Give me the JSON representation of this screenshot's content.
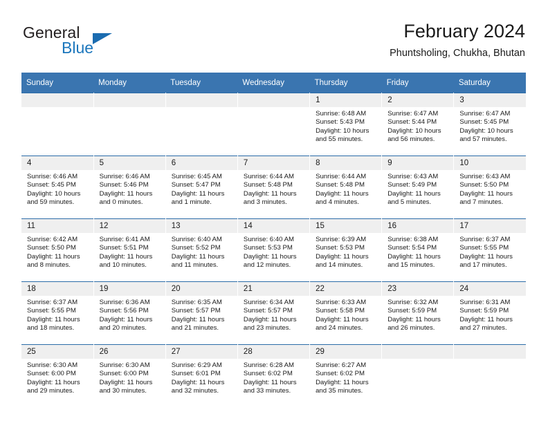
{
  "brand": {
    "name_part1": "General",
    "name_part2": "Blue",
    "logo_icon": "triangle-flag-icon"
  },
  "header": {
    "title": "February 2024",
    "location": "Phuntsholing, Chukha, Bhutan"
  },
  "theme": {
    "header_blue": "#3a75b0",
    "rule_blue": "#2b6ca8",
    "daynum_bg": "#efefef",
    "brand_blue": "#1b76bc",
    "text": "#1a1a1a"
  },
  "weekdays": [
    "Sunday",
    "Monday",
    "Tuesday",
    "Wednesday",
    "Thursday",
    "Friday",
    "Saturday"
  ],
  "labels": {
    "sunrise": "Sunrise:",
    "sunset": "Sunset:",
    "daylight": "Daylight:"
  },
  "weeks": [
    [
      {
        "day": "",
        "sunrise": "",
        "sunset": "",
        "daylight1": "",
        "daylight2": "",
        "empty": true
      },
      {
        "day": "",
        "sunrise": "",
        "sunset": "",
        "daylight1": "",
        "daylight2": "",
        "empty": true
      },
      {
        "day": "",
        "sunrise": "",
        "sunset": "",
        "daylight1": "",
        "daylight2": "",
        "empty": true
      },
      {
        "day": "",
        "sunrise": "",
        "sunset": "",
        "daylight1": "",
        "daylight2": "",
        "empty": true
      },
      {
        "day": "1",
        "sunrise": "Sunrise: 6:48 AM",
        "sunset": "Sunset: 5:43 PM",
        "daylight1": "Daylight: 10 hours",
        "daylight2": "and 55 minutes."
      },
      {
        "day": "2",
        "sunrise": "Sunrise: 6:47 AM",
        "sunset": "Sunset: 5:44 PM",
        "daylight1": "Daylight: 10 hours",
        "daylight2": "and 56 minutes."
      },
      {
        "day": "3",
        "sunrise": "Sunrise: 6:47 AM",
        "sunset": "Sunset: 5:45 PM",
        "daylight1": "Daylight: 10 hours",
        "daylight2": "and 57 minutes."
      }
    ],
    [
      {
        "day": "4",
        "sunrise": "Sunrise: 6:46 AM",
        "sunset": "Sunset: 5:45 PM",
        "daylight1": "Daylight: 10 hours",
        "daylight2": "and 59 minutes."
      },
      {
        "day": "5",
        "sunrise": "Sunrise: 6:46 AM",
        "sunset": "Sunset: 5:46 PM",
        "daylight1": "Daylight: 11 hours",
        "daylight2": "and 0 minutes."
      },
      {
        "day": "6",
        "sunrise": "Sunrise: 6:45 AM",
        "sunset": "Sunset: 5:47 PM",
        "daylight1": "Daylight: 11 hours",
        "daylight2": "and 1 minute."
      },
      {
        "day": "7",
        "sunrise": "Sunrise: 6:44 AM",
        "sunset": "Sunset: 5:48 PM",
        "daylight1": "Daylight: 11 hours",
        "daylight2": "and 3 minutes."
      },
      {
        "day": "8",
        "sunrise": "Sunrise: 6:44 AM",
        "sunset": "Sunset: 5:48 PM",
        "daylight1": "Daylight: 11 hours",
        "daylight2": "and 4 minutes."
      },
      {
        "day": "9",
        "sunrise": "Sunrise: 6:43 AM",
        "sunset": "Sunset: 5:49 PM",
        "daylight1": "Daylight: 11 hours",
        "daylight2": "and 5 minutes."
      },
      {
        "day": "10",
        "sunrise": "Sunrise: 6:43 AM",
        "sunset": "Sunset: 5:50 PM",
        "daylight1": "Daylight: 11 hours",
        "daylight2": "and 7 minutes."
      }
    ],
    [
      {
        "day": "11",
        "sunrise": "Sunrise: 6:42 AM",
        "sunset": "Sunset: 5:50 PM",
        "daylight1": "Daylight: 11 hours",
        "daylight2": "and 8 minutes."
      },
      {
        "day": "12",
        "sunrise": "Sunrise: 6:41 AM",
        "sunset": "Sunset: 5:51 PM",
        "daylight1": "Daylight: 11 hours",
        "daylight2": "and 10 minutes."
      },
      {
        "day": "13",
        "sunrise": "Sunrise: 6:40 AM",
        "sunset": "Sunset: 5:52 PM",
        "daylight1": "Daylight: 11 hours",
        "daylight2": "and 11 minutes."
      },
      {
        "day": "14",
        "sunrise": "Sunrise: 6:40 AM",
        "sunset": "Sunset: 5:53 PM",
        "daylight1": "Daylight: 11 hours",
        "daylight2": "and 12 minutes."
      },
      {
        "day": "15",
        "sunrise": "Sunrise: 6:39 AM",
        "sunset": "Sunset: 5:53 PM",
        "daylight1": "Daylight: 11 hours",
        "daylight2": "and 14 minutes."
      },
      {
        "day": "16",
        "sunrise": "Sunrise: 6:38 AM",
        "sunset": "Sunset: 5:54 PM",
        "daylight1": "Daylight: 11 hours",
        "daylight2": "and 15 minutes."
      },
      {
        "day": "17",
        "sunrise": "Sunrise: 6:37 AM",
        "sunset": "Sunset: 5:55 PM",
        "daylight1": "Daylight: 11 hours",
        "daylight2": "and 17 minutes."
      }
    ],
    [
      {
        "day": "18",
        "sunrise": "Sunrise: 6:37 AM",
        "sunset": "Sunset: 5:55 PM",
        "daylight1": "Daylight: 11 hours",
        "daylight2": "and 18 minutes."
      },
      {
        "day": "19",
        "sunrise": "Sunrise: 6:36 AM",
        "sunset": "Sunset: 5:56 PM",
        "daylight1": "Daylight: 11 hours",
        "daylight2": "and 20 minutes."
      },
      {
        "day": "20",
        "sunrise": "Sunrise: 6:35 AM",
        "sunset": "Sunset: 5:57 PM",
        "daylight1": "Daylight: 11 hours",
        "daylight2": "and 21 minutes."
      },
      {
        "day": "21",
        "sunrise": "Sunrise: 6:34 AM",
        "sunset": "Sunset: 5:57 PM",
        "daylight1": "Daylight: 11 hours",
        "daylight2": "and 23 minutes."
      },
      {
        "day": "22",
        "sunrise": "Sunrise: 6:33 AM",
        "sunset": "Sunset: 5:58 PM",
        "daylight1": "Daylight: 11 hours",
        "daylight2": "and 24 minutes."
      },
      {
        "day": "23",
        "sunrise": "Sunrise: 6:32 AM",
        "sunset": "Sunset: 5:59 PM",
        "daylight1": "Daylight: 11 hours",
        "daylight2": "and 26 minutes."
      },
      {
        "day": "24",
        "sunrise": "Sunrise: 6:31 AM",
        "sunset": "Sunset: 5:59 PM",
        "daylight1": "Daylight: 11 hours",
        "daylight2": "and 27 minutes."
      }
    ],
    [
      {
        "day": "25",
        "sunrise": "Sunrise: 6:30 AM",
        "sunset": "Sunset: 6:00 PM",
        "daylight1": "Daylight: 11 hours",
        "daylight2": "and 29 minutes."
      },
      {
        "day": "26",
        "sunrise": "Sunrise: 6:30 AM",
        "sunset": "Sunset: 6:00 PM",
        "daylight1": "Daylight: 11 hours",
        "daylight2": "and 30 minutes."
      },
      {
        "day": "27",
        "sunrise": "Sunrise: 6:29 AM",
        "sunset": "Sunset: 6:01 PM",
        "daylight1": "Daylight: 11 hours",
        "daylight2": "and 32 minutes."
      },
      {
        "day": "28",
        "sunrise": "Sunrise: 6:28 AM",
        "sunset": "Sunset: 6:02 PM",
        "daylight1": "Daylight: 11 hours",
        "daylight2": "and 33 minutes."
      },
      {
        "day": "29",
        "sunrise": "Sunrise: 6:27 AM",
        "sunset": "Sunset: 6:02 PM",
        "daylight1": "Daylight: 11 hours",
        "daylight2": "and 35 minutes."
      },
      {
        "day": "",
        "sunrise": "",
        "sunset": "",
        "daylight1": "",
        "daylight2": "",
        "empty": true
      },
      {
        "day": "",
        "sunrise": "",
        "sunset": "",
        "daylight1": "",
        "daylight2": "",
        "empty": true
      }
    ]
  ]
}
